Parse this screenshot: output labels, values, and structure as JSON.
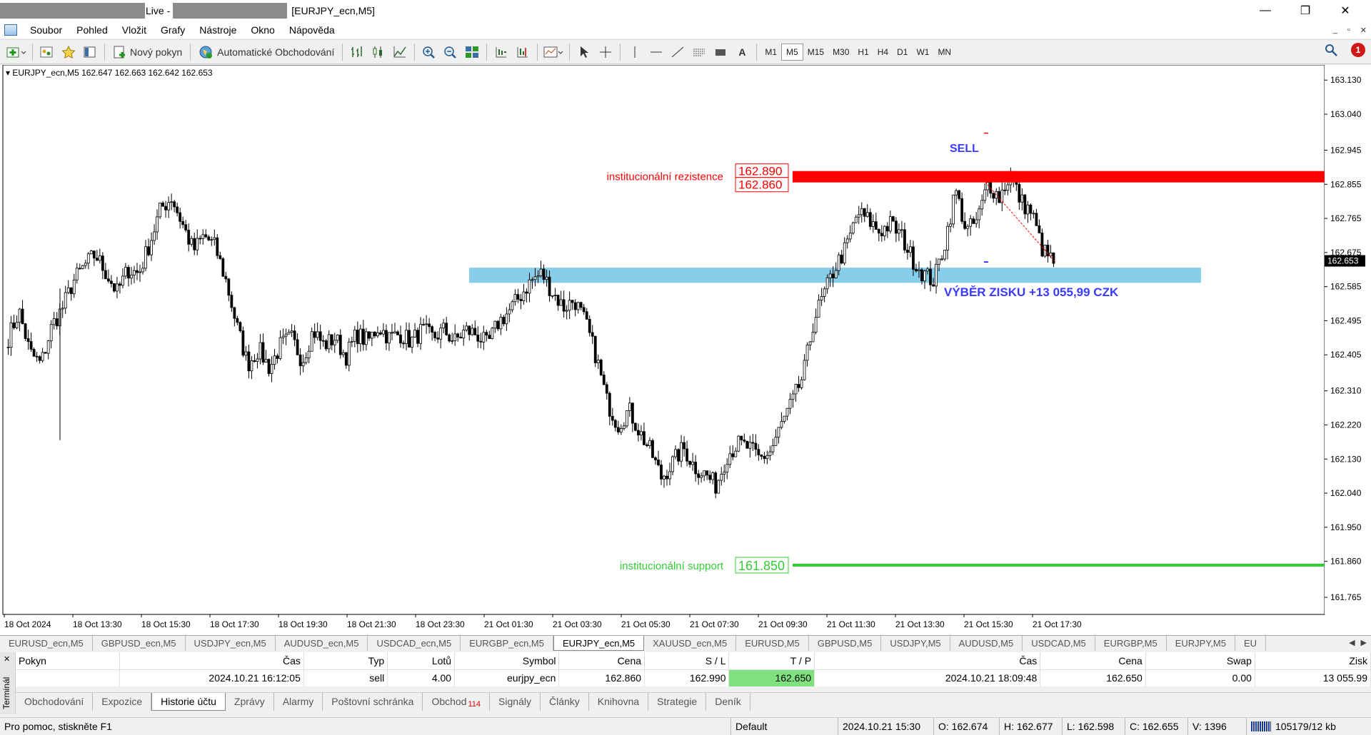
{
  "window": {
    "title_live": "Live -",
    "title_symbol": "[EURJPY_ecn,M5]",
    "min_glyph": "—",
    "max_glyph": "❐",
    "close_glyph": "✕"
  },
  "menu": [
    "Soubor",
    "Pohled",
    "Vložit",
    "Grafy",
    "Nástroje",
    "Okno",
    "Nápověda"
  ],
  "toolbar": {
    "new_order_label": "Nový pokyn",
    "auto_trading_label": "Automatické Obchodování",
    "timeframes": [
      "M1",
      "M5",
      "M15",
      "M30",
      "H1",
      "H4",
      "D1",
      "W1",
      "MN"
    ],
    "active_timeframe": "M5",
    "text_tool": "A",
    "alert_count": "1"
  },
  "chart": {
    "header": "EURJPY_ecn,M5  162.647 162.663 162.642 162.653",
    "current_price": "162.653",
    "resistance_label": "institucionální rezistence",
    "resistance_tag_upper": "162.890",
    "resistance_tag_lower": "162.860",
    "support_label": "institucionální support",
    "support_tag": "161.850",
    "sell_label": "SELL",
    "profit_label": "VÝBĚR ZISKU +13 055,99 CZK",
    "colors": {
      "resistance": "#ff0000",
      "support": "#33cc33",
      "zone": "#87ceeb",
      "annotation": "#3a3aff",
      "candle": "#000000"
    }
  },
  "chart_data": {
    "type": "candlestick",
    "symbol": "EURJPY_ecn",
    "timeframe": "M5",
    "ylim": [
      161.72,
      163.17
    ],
    "y_ticks": [
      "163.130",
      "163.040",
      "162.945",
      "162.855",
      "162.765",
      "162.675",
      "162.585",
      "162.495",
      "162.405",
      "162.310",
      "162.220",
      "162.130",
      "162.040",
      "161.950",
      "161.860",
      "161.765"
    ],
    "x_ticks": [
      "18 Oct 2024",
      "18 Oct 13:30",
      "18 Oct 15:30",
      "18 Oct 17:30",
      "18 Oct 19:30",
      "18 Oct 21:30",
      "18 Oct 23:30",
      "21 Oct 01:30",
      "21 Oct 03:30",
      "21 Oct 05:30",
      "21 Oct 07:30",
      "21 Oct 09:30",
      "21 Oct 11:30",
      "21 Oct 13:30",
      "21 Oct 15:30",
      "21 Oct 17:30"
    ],
    "close_path": [
      162.45,
      162.52,
      162.41,
      162.38,
      162.48,
      162.53,
      162.6,
      162.64,
      162.67,
      162.62,
      162.57,
      162.63,
      162.62,
      162.7,
      162.79,
      162.82,
      162.75,
      162.68,
      162.72,
      162.69,
      162.6,
      162.48,
      162.38,
      162.42,
      162.37,
      162.43,
      162.45,
      162.39,
      162.47,
      162.43,
      162.45,
      162.4,
      162.46,
      162.44,
      162.48,
      162.45,
      162.46,
      162.44,
      162.47,
      162.45,
      162.47,
      162.44,
      162.47,
      162.46,
      162.43,
      162.49,
      162.52,
      162.56,
      162.6,
      162.62,
      162.57,
      162.53,
      162.55,
      162.49,
      162.4,
      162.28,
      162.22,
      162.26,
      162.2,
      162.15,
      162.08,
      162.12,
      162.16,
      162.11,
      162.09,
      162.06,
      162.14,
      162.17,
      162.16,
      162.13,
      162.15,
      162.22,
      162.28,
      162.35,
      162.5,
      162.57,
      162.64,
      162.69,
      162.78,
      162.76,
      162.73,
      162.75,
      162.72,
      162.66,
      162.62,
      162.6,
      162.7,
      162.84,
      162.73,
      162.76,
      162.86,
      162.82,
      162.88,
      162.81,
      162.78,
      162.68,
      162.65
    ],
    "series": [
      {
        "name": "institucionální rezistence",
        "type": "zone",
        "y_range": [
          162.86,
          162.89
        ]
      },
      {
        "name": "institucionální support",
        "type": "hline",
        "y": 161.85
      }
    ]
  },
  "chart_tabs": [
    "EURUSD_ecn,M5",
    "GBPUSD_ecn,M5",
    "USDJPY_ecn,M5",
    "AUDUSD_ecn,M5",
    "USDCAD_ecn,M5",
    "EURGBP_ecn,M5",
    "EURJPY_ecn,M5",
    "XAUUSD_ecn,M5",
    "EURUSD,M5",
    "GBPUSD,M5",
    "USDJPY,M5",
    "AUDUSD,M5",
    "USDCAD,M5",
    "EURGBP,M5",
    "EURJPY,M5",
    "EU"
  ],
  "active_chart_tab": "EURJPY_ecn,M5",
  "terminal": {
    "side_label": "Terminál",
    "columns": [
      "Pokyn",
      "Čas",
      "Typ",
      "Lotů",
      "Symbol",
      "Cena",
      "S / L",
      "T / P",
      "Čas",
      "Cena",
      "Swap",
      "Zisk"
    ],
    "row": {
      "time": "2024.10.21 16:12:05",
      "type": "sell",
      "lots": "4.00",
      "symbol": "eurjpy_ecn",
      "price": "162.860",
      "sl": "162.990",
      "tp": "162.650",
      "close_time": "2024.10.21 18:09:48",
      "close_price": "162.650",
      "swap": "0.00",
      "profit": "13 055.99"
    },
    "tabs": [
      "Obchodování",
      "Expozice",
      "Historie účtu",
      "Zprávy",
      "Alarmy",
      "Poštovní schránka",
      "Obchod",
      "Signály",
      "Články",
      "Knihovna",
      "Strategie",
      "Deník"
    ],
    "active_tab": "Historie účtu",
    "trade_tab_count": "114"
  },
  "status": {
    "help": "Pro pomoc, stiskněte F1",
    "profile": "Default",
    "time": "2024.10.21 15:30",
    "open": "O: 162.674",
    "high": "H: 162.677",
    "low": "L: 162.598",
    "close": "C: 162.655",
    "volume": "V: 1396",
    "traffic": "105179/12 kb"
  }
}
